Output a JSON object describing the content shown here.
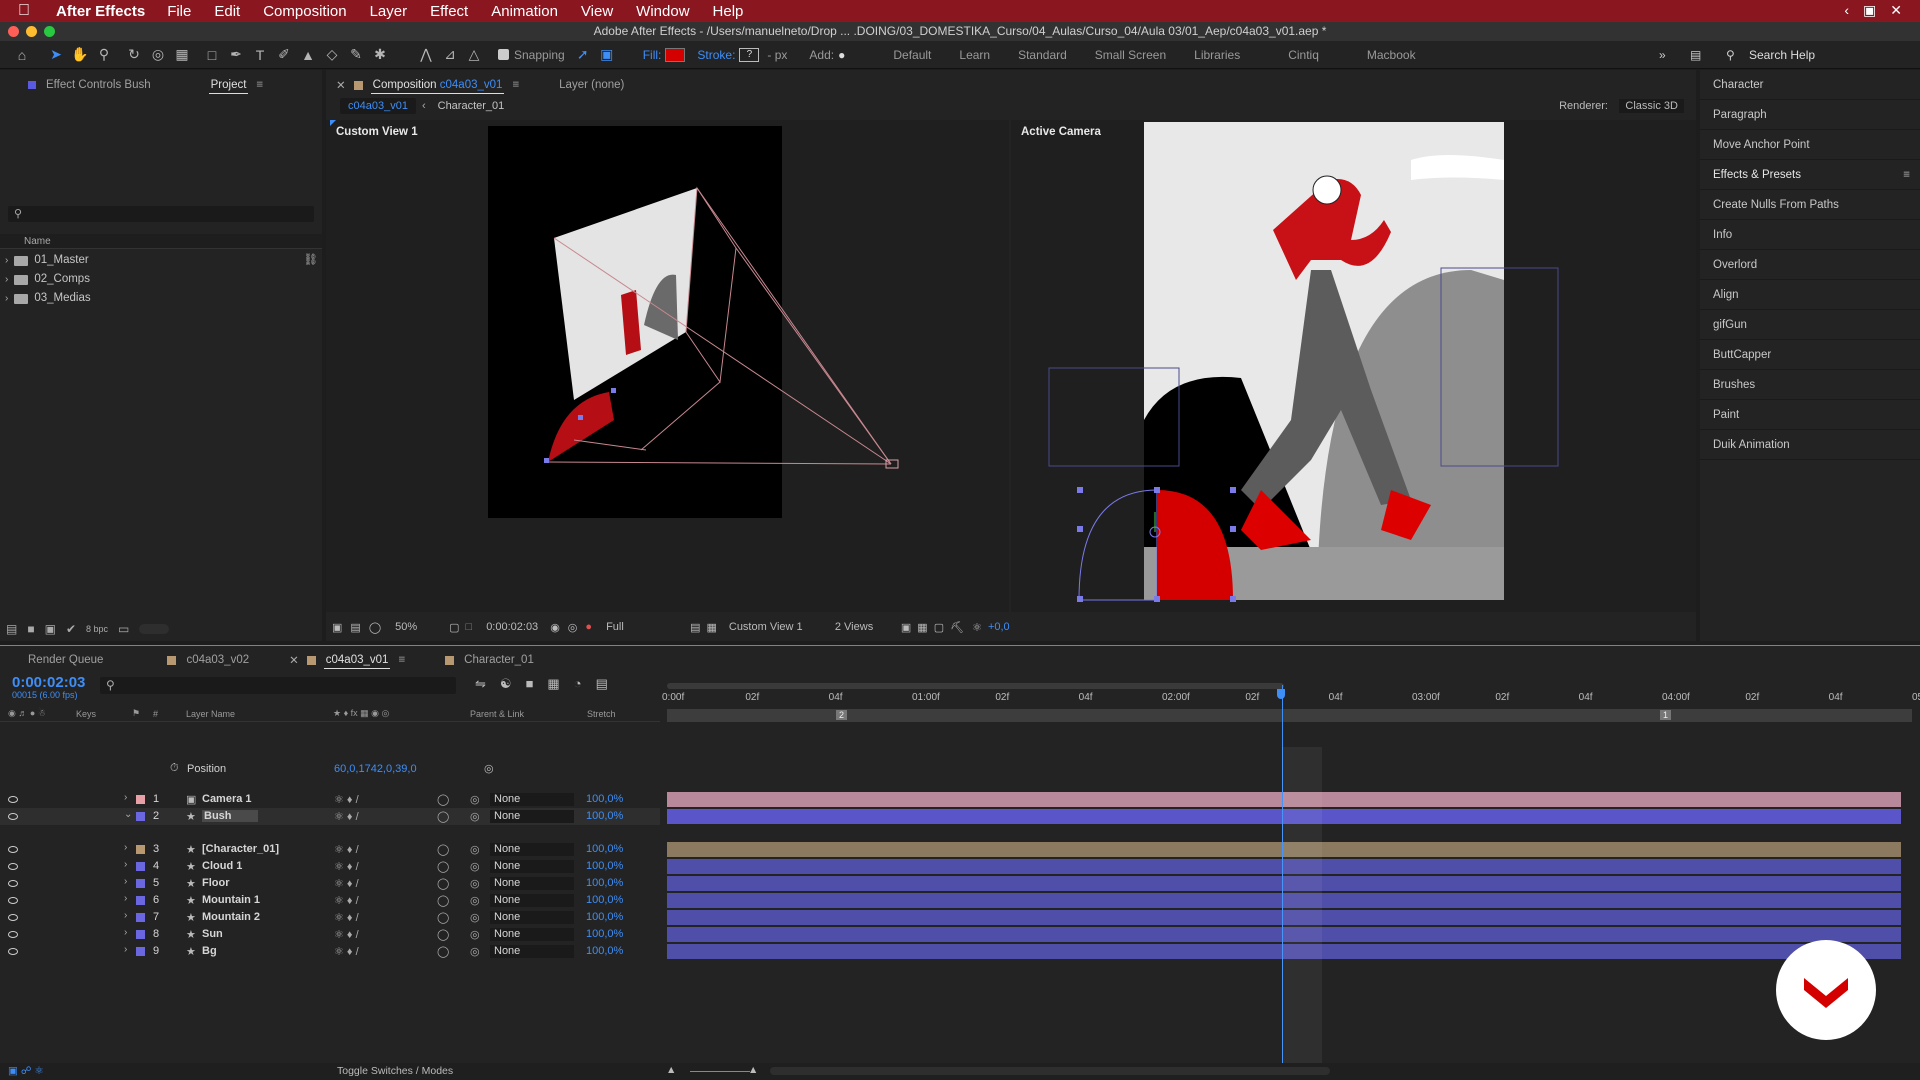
{
  "menubar": {
    "app": "After Effects",
    "items": [
      "File",
      "Edit",
      "Composition",
      "Layer",
      "Effect",
      "Animation",
      "View",
      "Window",
      "Help"
    ]
  },
  "window_title": "Adobe After Effects - /Users/manuelneto/Drop ... .DOING/03_DOMESTIKA_Curso/04_Aulas/Curso_04/Aula 03/01_Aep/c04a03_v01.aep *",
  "toolbar": {
    "snapping": "Snapping",
    "fill": "Fill:",
    "stroke": "Stroke:",
    "stroke_value": "?",
    "px": "- px",
    "add": "Add:",
    "workspaces": [
      "Default",
      "Learn",
      "Standard",
      "Small Screen",
      "Libraries",
      "Cintiq",
      "Macbook"
    ],
    "search_placeholder": "Search Help",
    "fill_color": "#d40000"
  },
  "project": {
    "tabs": [
      "Effect Controls Bush",
      "Project"
    ],
    "col_name": "Name",
    "items": [
      "01_Master",
      "02_Comps",
      "03_Medias"
    ],
    "bpc": "8 bpc"
  },
  "composition": {
    "tab": "Composition",
    "tab_name": "c04a03_v01",
    "layer_tab": "Layer (none)",
    "crumbs": [
      "c04a03_v01",
      "Character_01"
    ],
    "renderer_label": "Renderer:",
    "renderer_value": "Classic 3D",
    "left_view": "Custom View 1",
    "right_view": "Active Camera",
    "bottom": {
      "zoom": "50%",
      "time": "0:00:02:03",
      "quality": "Full",
      "view": "Custom View 1",
      "views": "2 Views",
      "exposure": "+0,0"
    }
  },
  "right_panel": {
    "items": [
      "Character",
      "Paragraph",
      "Move Anchor Point",
      "Effects & Presets",
      "Create Nulls From Paths",
      "Info",
      "Overlord",
      "Align",
      "gifGun",
      "ButtCapper",
      "Brushes",
      "Paint",
      "Duik Animation"
    ]
  },
  "timeline": {
    "tabs": [
      "Render Queue",
      "c04a03_v02",
      "c04a03_v01",
      "Character_01"
    ],
    "timecode": "0:00:02:03",
    "frames": "00015 (6.00 fps)",
    "headers": {
      "keys": "Keys",
      "num": "#",
      "name": "Layer Name",
      "parent": "Parent & Link",
      "stretch": "Stretch"
    },
    "ruler": [
      "0:00f",
      "02f",
      "04f",
      "01:00f",
      "02f",
      "04f",
      "02:00f",
      "02f",
      "04f",
      "03:00f",
      "02f",
      "04f",
      "04:00f",
      "02f",
      "04f",
      "05:0"
    ],
    "layers": [
      {
        "num": "1",
        "name": "Camera 1",
        "parent": "None",
        "stretch": "100,0%",
        "color": "#e8a0a8",
        "bar": "#b8899a"
      },
      {
        "num": "2",
        "name": "Bush",
        "parent": "None",
        "stretch": "100,0%",
        "color": "#6a67e0",
        "bar": "#5a55c8"
      },
      {
        "num": "3",
        "name": "[Character_01]",
        "parent": "None",
        "stretch": "100,0%",
        "color": "#b89870",
        "bar": "#8c7a60"
      },
      {
        "num": "4",
        "name": "Cloud 1",
        "parent": "None",
        "stretch": "100,0%",
        "color": "#6a67e0",
        "bar": "#4f4ea8"
      },
      {
        "num": "5",
        "name": "Floor",
        "parent": "None",
        "stretch": "100,0%",
        "color": "#6a67e0",
        "bar": "#4f4ea8"
      },
      {
        "num": "6",
        "name": "Mountain 1",
        "parent": "None",
        "stretch": "100,0%",
        "color": "#6a67e0",
        "bar": "#4f4ea8"
      },
      {
        "num": "7",
        "name": "Mountain 2",
        "parent": "None",
        "stretch": "100,0%",
        "color": "#6a67e0",
        "bar": "#4f4ea8"
      },
      {
        "num": "8",
        "name": "Sun",
        "parent": "None",
        "stretch": "100,0%",
        "color": "#6a67e0",
        "bar": "#4f4ea8"
      },
      {
        "num": "9",
        "name": "Bg",
        "parent": "None",
        "stretch": "100,0%",
        "color": "#6a67e0",
        "bar": "#4f4ea8"
      }
    ],
    "position_label": "Position",
    "position_value": "60,0,1742,0,39,0",
    "marker_2": "2",
    "marker_1": "1",
    "toggle": "Toggle Switches / Modes"
  }
}
